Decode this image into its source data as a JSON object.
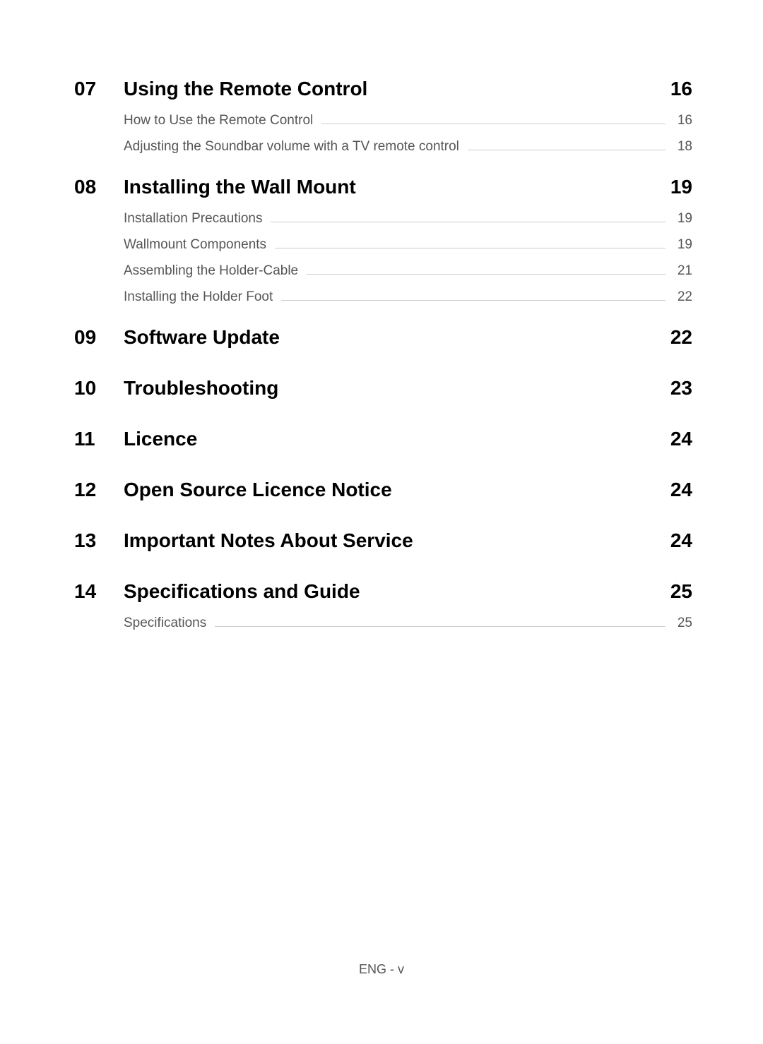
{
  "sections": [
    {
      "number": "07",
      "title": "Using the Remote Control",
      "page": "16",
      "subsections": [
        {
          "title": "How to Use the Remote Control",
          "page": "16"
        },
        {
          "title": "Adjusting the Soundbar volume with a TV remote control",
          "page": "18"
        }
      ]
    },
    {
      "number": "08",
      "title": "Installing the Wall Mount",
      "page": "19",
      "subsections": [
        {
          "title": "Installation Precautions",
          "page": "19"
        },
        {
          "title": "Wallmount Components",
          "page": "19"
        },
        {
          "title": "Assembling the Holder-Cable",
          "page": "21"
        },
        {
          "title": "Installing the Holder Foot",
          "page": "22"
        }
      ]
    },
    {
      "number": "09",
      "title": "Software Update",
      "page": "22",
      "subsections": []
    },
    {
      "number": "10",
      "title": "Troubleshooting",
      "page": "23",
      "subsections": []
    },
    {
      "number": "11",
      "title": "Licence",
      "page": "24",
      "subsections": []
    },
    {
      "number": "12",
      "title": "Open Source Licence Notice",
      "page": "24",
      "subsections": []
    },
    {
      "number": "13",
      "title": "Important Notes About Service",
      "page": "24",
      "subsections": []
    },
    {
      "number": "14",
      "title": "Specifications and Guide",
      "page": "25",
      "subsections": [
        {
          "title": "Specifications",
          "page": "25"
        }
      ]
    }
  ],
  "footer": "ENG - v"
}
